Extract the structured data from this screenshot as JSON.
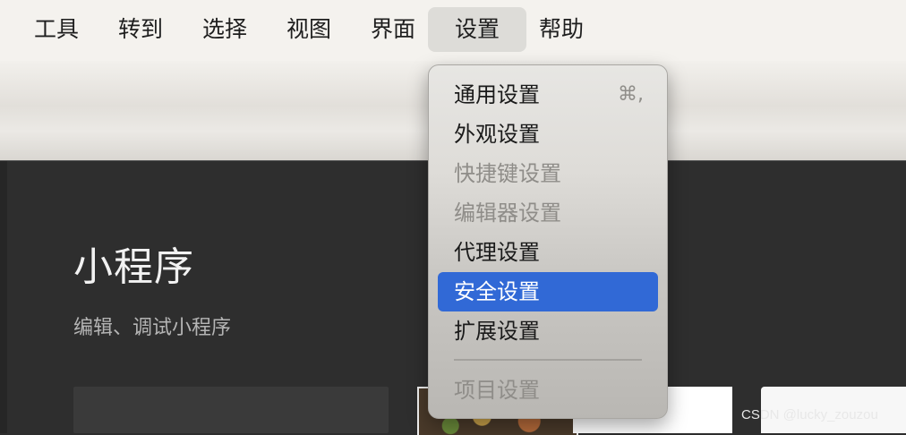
{
  "menubar": {
    "items": [
      {
        "label": "工具"
      },
      {
        "label": "转到"
      },
      {
        "label": "选择"
      },
      {
        "label": "视图"
      },
      {
        "label": "界面"
      },
      {
        "label": "设置",
        "active": true
      },
      {
        "label": "帮助"
      }
    ]
  },
  "dropdown": {
    "items": [
      {
        "label": "通用设置",
        "shortcut": "⌘,",
        "enabled": true
      },
      {
        "label": "外观设置",
        "enabled": true
      },
      {
        "label": "快捷键设置",
        "enabled": false
      },
      {
        "label": "编辑器设置",
        "enabled": false
      },
      {
        "label": "代理设置",
        "enabled": true
      },
      {
        "label": "安全设置",
        "enabled": true,
        "selected": true
      },
      {
        "label": "扩展设置",
        "enabled": true
      },
      {
        "label": "项目设置",
        "enabled": false
      }
    ]
  },
  "app": {
    "title": "小程序",
    "subtitle": "编辑、调试小程序"
  },
  "watermark": "CSDN @lucky_zouzou",
  "colors": {
    "selection": "#3169d6",
    "menubar_bg": "#f4f2ee",
    "app_bg": "#2e2e2e"
  }
}
